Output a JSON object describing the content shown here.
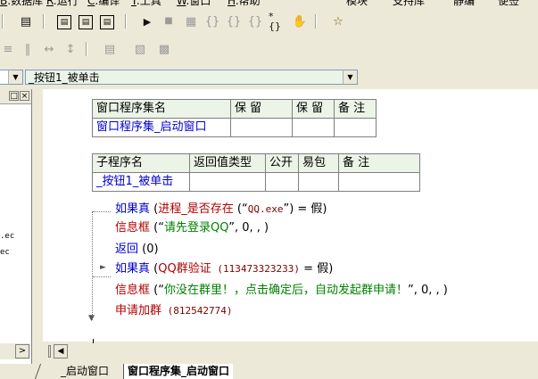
{
  "menu": {
    "items": [
      {
        "key": "B",
        "label": "数据库"
      },
      {
        "key": "R",
        "label": "运行"
      },
      {
        "key": "C",
        "label": "编译"
      },
      {
        "key": "T",
        "label": "工具"
      },
      {
        "key": "W",
        "label": "窗口"
      },
      {
        "key": "H",
        "label": "帮助"
      }
    ],
    "extra": [
      "模块",
      "支持库",
      "静编",
      "便签"
    ]
  },
  "selector": {
    "left_value": "",
    "right_value": "_按钮1_被单击"
  },
  "left_panel": {
    "line1": ".ec",
    "line2": "ec"
  },
  "window_table": {
    "headers": [
      "窗口程序集名",
      "保 留",
      "保 留",
      "备 注"
    ],
    "row": [
      "窗口程序集_启动窗口",
      "",
      "",
      ""
    ]
  },
  "sub_table": {
    "headers": [
      "子程序名",
      "返回值类型",
      "公开",
      "易包",
      "备 注"
    ],
    "row": [
      "_按钮1_被单击",
      "",
      "",
      "",
      ""
    ]
  },
  "code": {
    "line1": {
      "kw": "如果真",
      "open": " (",
      "fn": "进程_是否存在",
      "args": " (“",
      "str": "QQ.exe",
      "close": "”) = 假)"
    },
    "line2": {
      "fn": "信息框",
      "open": " (“",
      "str": "请先登录QQ",
      "rest": "”, 0, , )"
    },
    "line3": {
      "fn": "返回",
      "rest": " (0)"
    },
    "line4": {
      "kw": "如果真",
      "open": " (",
      "fn": "QQ群验证",
      "num": " (113473323233)",
      "rest": " = 假)"
    },
    "line5": {
      "fn": "信息框",
      "open": " (“",
      "str": "你没在群里！，点击确定后，自动发起群申请！",
      "rest": "”, 0, , )"
    },
    "line6": {
      "fn": "申请加群",
      "num": " (812542774)"
    }
  },
  "tabs": [
    "_启动窗口",
    "窗口程序集_启动窗口"
  ]
}
